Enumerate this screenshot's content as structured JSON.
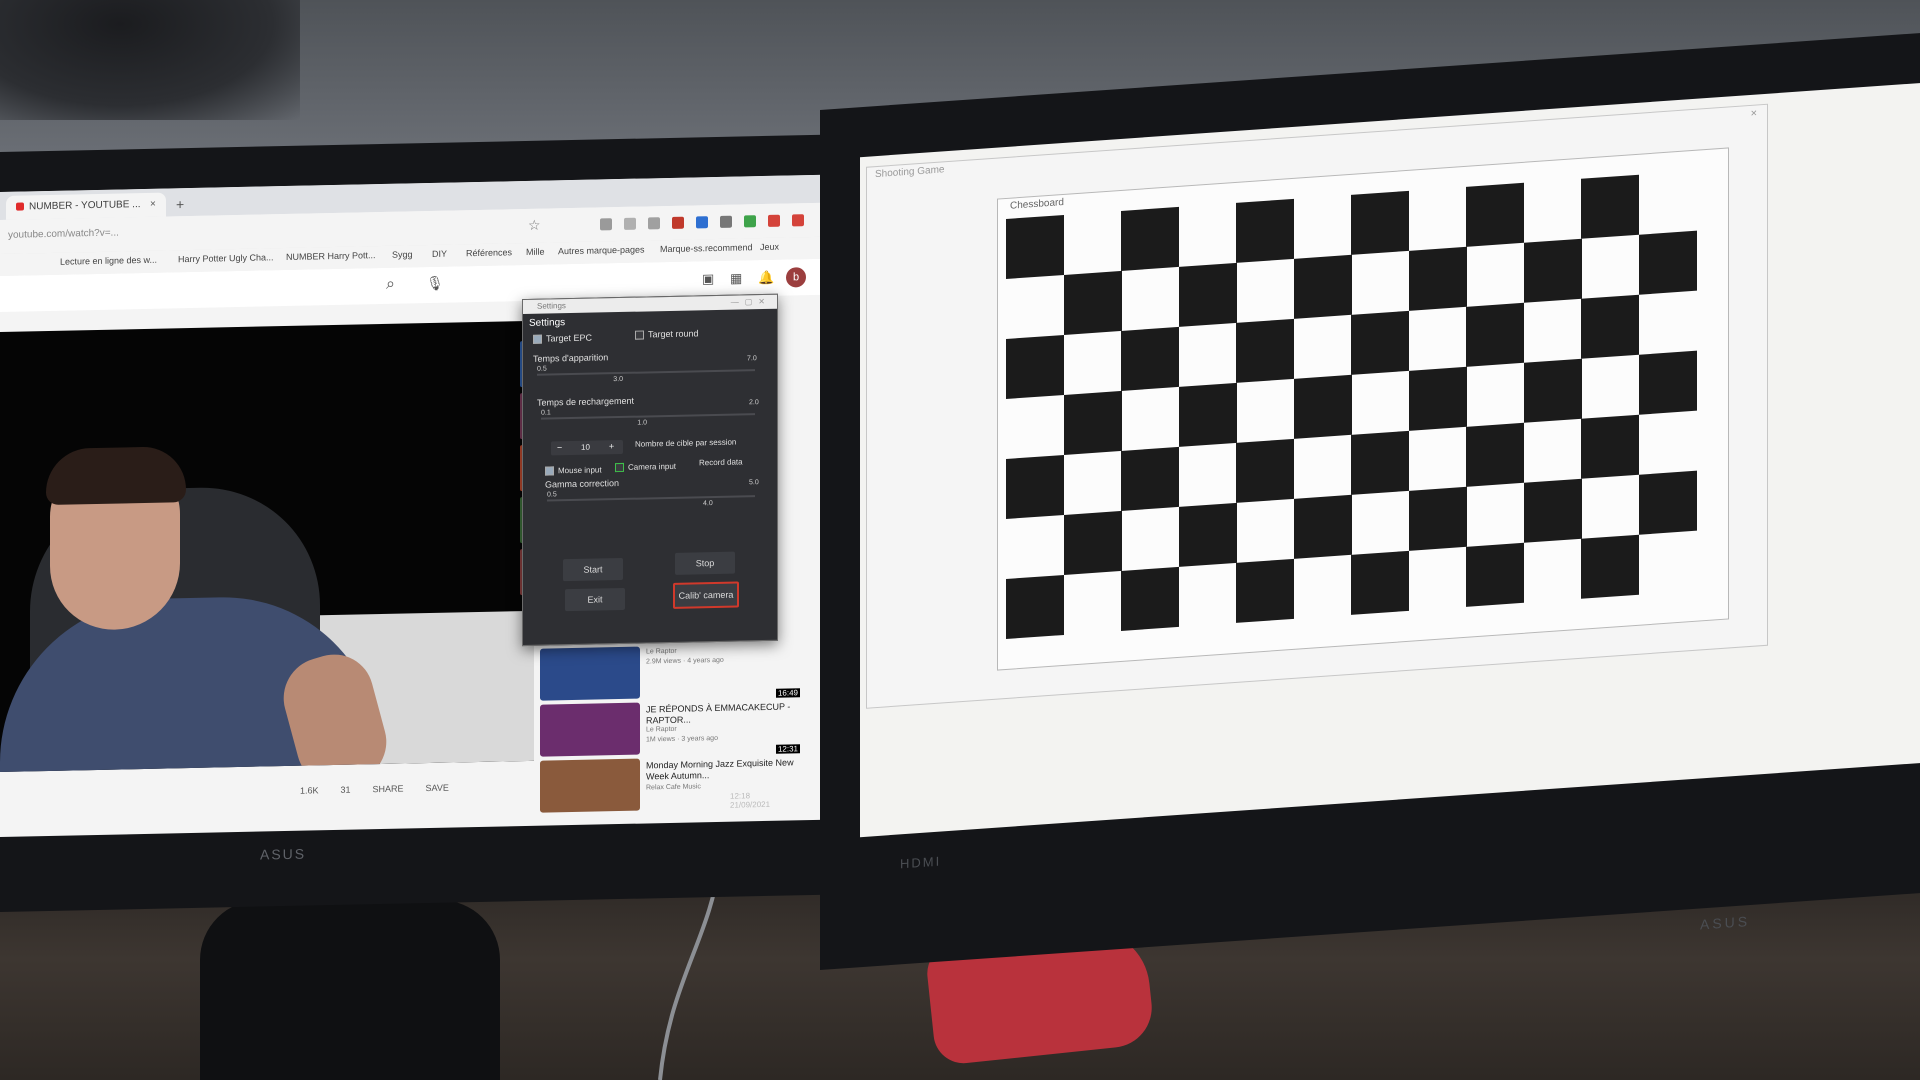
{
  "browser": {
    "tab_title": "NUMBER - YOUTUBE ...",
    "tab_close": "×",
    "new_tab": "+",
    "url": "youtube.com/watch?v=...",
    "bookmarks": [
      "Lecture en ligne des w...",
      "Harry Potter Ugly Cha...",
      "NUMBER Harry Pott...",
      "Sygg",
      "DIY",
      "Références",
      "Mille",
      "Autres marque-pages",
      "Marque-ss.recommend",
      "Jeux"
    ]
  },
  "youtube": {
    "avatar_letter": "b",
    "actions": [
      "1.6K",
      "31",
      "SHARE",
      "SAVE"
    ],
    "recommendations": [
      {
        "title": "",
        "channel": "Le Raptor",
        "meta": "2.9M views · 4 years ago",
        "duration": "16:49",
        "thumb_color": "#2b4a8a"
      },
      {
        "title": "JE RÉPONDS À EMMACAKECUP - RAPTOR...",
        "channel": "Le Raptor",
        "meta": "1M views · 3 years ago",
        "duration": "12:31",
        "thumb_color": "#6b2d6d"
      },
      {
        "title": "Monday Morning Jazz Exquisite New Week Autumn...",
        "channel": "Relax Cafe Music",
        "meta": "",
        "duration": "",
        "thumb_color": "#8a5a3c"
      }
    ]
  },
  "settings": {
    "window_title": "Settings",
    "inner_title": "Settings",
    "target_a": "Target EPC",
    "target_b": "Target round",
    "appearance_label": "Temps d'apparition",
    "appearance_min": "0.5",
    "appearance_value": "3.0",
    "appearance_max": "7.0",
    "appearance_level": 0.35,
    "reload_label": "Temps de rechargement",
    "reload_min": "0.1",
    "reload_value": "1.0",
    "reload_max": "2.0",
    "reload_level": 0.45,
    "stepper_minus": "−",
    "stepper_value": "10",
    "stepper_plus": "+",
    "targets_label": "Nombre de cible par session",
    "mouse_input": "Mouse input",
    "camera_input": "Camera input",
    "record_data": "Record data",
    "gamma_label": "Gamma correction",
    "gamma_min": "0.5",
    "gamma_value": "4.0",
    "gamma_max": "5.0",
    "gamma_level": 0.75,
    "start": "Start",
    "stop": "Stop",
    "exit": "Exit",
    "calibrate": "Calib' camera"
  },
  "taskbar_left": {
    "time": "12:18",
    "date": "21/09/2021",
    "apps": [
      "#c9a227",
      "#3a7bd5",
      "#d84a3a",
      "#2aa84a",
      "#e4e4e4",
      "#b23c3c",
      "#23a455",
      "#9aa3ad"
    ]
  },
  "right_monitor": {
    "outer_title": "Shooting Game",
    "outer_close": "×",
    "chess_title": "Chessboard",
    "chess_rows": 7,
    "chess_cols": 12,
    "apps": [
      "#d8c06a",
      "#5e6a77",
      "#e6e6e6",
      "#3a88c8",
      "#d84a3a",
      "#2aa84a",
      "#9aa3ad"
    ]
  },
  "colors": {
    "settings_bg": "#2e2f33",
    "calib_border": "#d0392b",
    "chess_dark": "#1b1b1b"
  },
  "bezel": {
    "left_brand": "ASUS",
    "right_brand_left": "HDMI",
    "right_brand_bottom": "ASUS"
  }
}
